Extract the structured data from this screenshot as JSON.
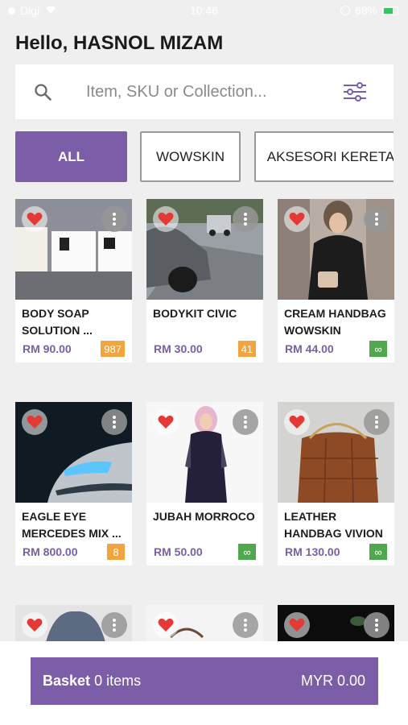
{
  "status_bar": {
    "carrier": "Digi",
    "time": "10:46",
    "battery": "68%"
  },
  "greeting": "Hello, HASNOL MIZAM",
  "search": {
    "placeholder": "Item, SKU or Collection..."
  },
  "chips": [
    {
      "label": "ALL",
      "active": true
    },
    {
      "label": "WOWSKIN",
      "active": false
    },
    {
      "label": "AKSESORI KERETA",
      "active": false
    }
  ],
  "products": [
    {
      "name": "BODY SOAP SOLUTION ...",
      "price": "RM 90.00",
      "stock": "987",
      "stock_color": "#f2a53e"
    },
    {
      "name": "BODYKIT CIVIC",
      "price": "RM 30.00",
      "stock": "41",
      "stock_color": "#f2a53e"
    },
    {
      "name": "CREAM HANDBAG WOWSKIN",
      "price": "RM 44.00",
      "stock": "∞",
      "stock_color": "#4fa84d"
    },
    {
      "name": "EAGLE EYE MERCEDES MIX ...",
      "price": "RM 800.00",
      "stock": "8",
      "stock_color": "#f2a53e"
    },
    {
      "name": "JUBAH MORROCO",
      "price": "RM 50.00",
      "stock": "∞",
      "stock_color": "#4fa84d"
    },
    {
      "name": "LEATHER HANDBAG VIVION",
      "price": "RM 130.00",
      "stock": "∞",
      "stock_color": "#4fa84d"
    }
  ],
  "basket": {
    "label": "Basket",
    "count": "0 items",
    "total": "MYR 0.00"
  },
  "colors": {
    "accent": "#7b5ea7",
    "heart": "#e53935",
    "stock_low": "#f2a53e",
    "stock_unlimited": "#4fa84d"
  }
}
